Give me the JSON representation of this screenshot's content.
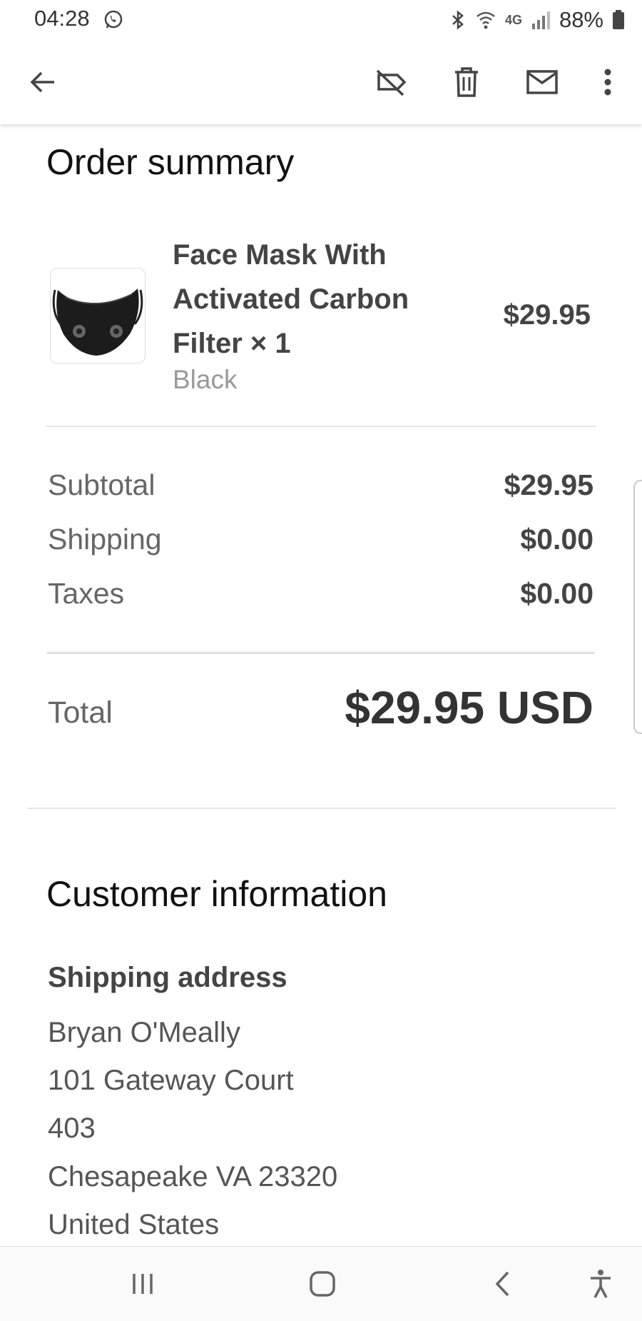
{
  "status_bar": {
    "time": "04:28",
    "battery": "88%",
    "network": "4G"
  },
  "app_bar": {
    "icons": [
      "back-arrow-icon",
      "label-off-icon",
      "trash-icon",
      "mail-icon",
      "more-vert-icon"
    ]
  },
  "order_summary": {
    "heading": "Order summary",
    "item": {
      "name": "Face Mask With Activated Carbon Filter × 1",
      "variant": "Black",
      "price": "$29.95"
    },
    "rows": [
      {
        "label": "Subtotal",
        "value": "$29.95"
      },
      {
        "label": "Shipping",
        "value": "$0.00"
      },
      {
        "label": "Taxes",
        "value": "$0.00"
      }
    ],
    "total_label": "Total",
    "total_value": "$29.95 USD"
  },
  "customer": {
    "heading": "Customer information",
    "shipping_heading": "Shipping address",
    "address_lines": [
      "Bryan O'Meally",
      "101 Gateway Court",
      "403",
      "Chesapeake VA 23320",
      "United States"
    ]
  },
  "nav_bar": {
    "icons": [
      "recent-apps-icon",
      "home-icon",
      "back-icon",
      "accessibility-icon"
    ]
  }
}
